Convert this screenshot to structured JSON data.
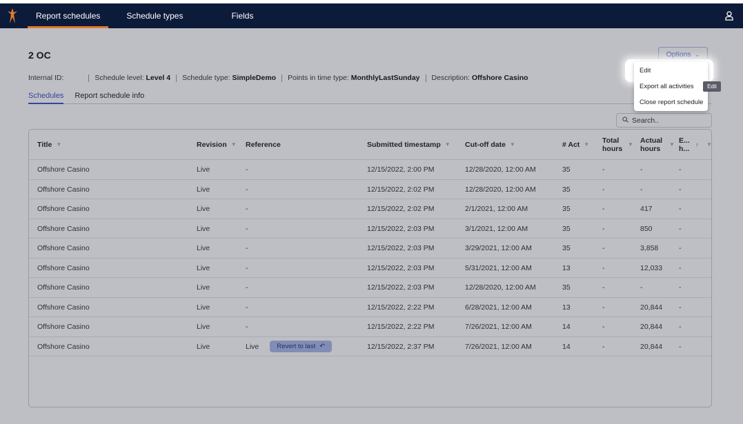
{
  "nav": {
    "tabs": [
      "Report schedules",
      "Schedule types",
      "Fields"
    ]
  },
  "schedule": {
    "title": "2 OC",
    "internal_id_label": "Internal ID:",
    "schedule_level_label": "Schedule level:",
    "schedule_level_value": "Level 4",
    "schedule_type_label": "Schedule type:",
    "schedule_type_value": "SimpleDemo",
    "points_type_label": "Points in time type:",
    "points_type_value": "MonthlyLastSunday",
    "description_label": "Description:",
    "description_value": "Offshore Casino"
  },
  "subtabs": [
    "Schedules",
    "Report schedule info"
  ],
  "options": {
    "label": "Options",
    "menu": [
      "Edit",
      "Export all activities",
      "Close report schedule"
    ],
    "tooltip": "Edit"
  },
  "search": {
    "placeholder": "Search.."
  },
  "table": {
    "columns": [
      "Title",
      "Revision",
      "Reference",
      "Submitted timestamp",
      "Cut-off date",
      "# Act",
      "Total hours",
      "Actual hours",
      "E... h..."
    ],
    "rows": [
      [
        "Offshore Casino",
        "Live",
        "-",
        "12/15/2022, 2:00 PM",
        "12/28/2020, 12:00 AM",
        "35",
        "-",
        "-",
        "-"
      ],
      [
        "Offshore Casino",
        "Live",
        "-",
        "12/15/2022, 2:02 PM",
        "12/28/2020, 12:00 AM",
        "35",
        "-",
        "-",
        "-"
      ],
      [
        "Offshore Casino",
        "Live",
        "-",
        "12/15/2022, 2:02 PM",
        "2/1/2021, 12:00 AM",
        "35",
        "-",
        "417",
        "-"
      ],
      [
        "Offshore Casino",
        "Live",
        "-",
        "12/15/2022, 2:03 PM",
        "3/1/2021, 12:00 AM",
        "35",
        "-",
        "850",
        "-"
      ],
      [
        "Offshore Casino",
        "Live",
        "-",
        "12/15/2022, 2:03 PM",
        "3/29/2021, 12:00 AM",
        "35",
        "-",
        "3,858",
        "-"
      ],
      [
        "Offshore Casino",
        "Live",
        "-",
        "12/15/2022, 2:03 PM",
        "5/31/2021, 12:00 AM",
        "13",
        "-",
        "12,033",
        "-"
      ],
      [
        "Offshore Casino",
        "Live",
        "-",
        "12/15/2022, 2:03 PM",
        "12/28/2020, 12:00 AM",
        "35",
        "-",
        "-",
        "-"
      ],
      [
        "Offshore Casino",
        "Live",
        "-",
        "12/15/2022, 2:22 PM",
        "6/28/2021, 12:00 AM",
        "13",
        "-",
        "20,844",
        "-"
      ],
      [
        "Offshore Casino",
        "Live",
        "-",
        "12/15/2022, 2:22 PM",
        "7/26/2021, 12:00 AM",
        "14",
        "-",
        "20,844",
        "-"
      ],
      [
        "Offshore Casino",
        "Live",
        "Live",
        "12/15/2022, 2:37 PM",
        "7/26/2021, 12:00 AM",
        "14",
        "-",
        "20,844",
        "-"
      ]
    ],
    "revert_label": "Revert to last"
  },
  "colors": {
    "nav_bg": "#0d1b3a",
    "accent": "#3453c7",
    "nav_active": "#e07b2b"
  },
  "icons": {
    "logo": "logo-icon",
    "user": "user-icon",
    "search": "search-icon",
    "undo": "undo-icon",
    "filter": "filter-icon"
  }
}
